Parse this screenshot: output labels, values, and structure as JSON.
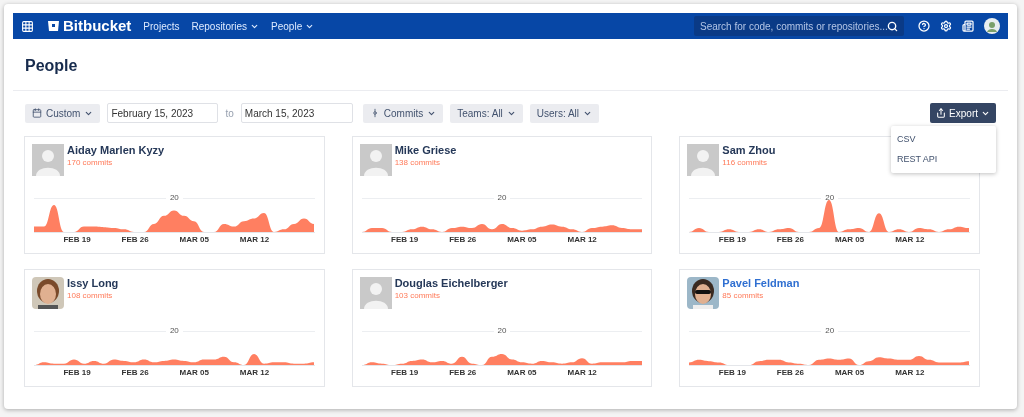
{
  "nav": {
    "product": "Bitbucket",
    "links": [
      {
        "label": "Projects",
        "has_menu": false
      },
      {
        "label": "Repositories",
        "has_menu": true
      },
      {
        "label": "People",
        "has_menu": true
      }
    ],
    "search": {
      "placeholder": "Search for code, commits or repositories..."
    }
  },
  "page": {
    "title": "People"
  },
  "filters": {
    "range": "Custom",
    "from": "February 15, 2023",
    "to_label": "to",
    "to": "March 15, 2023",
    "metric": "Commits",
    "teams": "Teams: All",
    "users": "Users: All"
  },
  "export": {
    "label": "Export",
    "expanded": true,
    "options": [
      "CSV",
      "REST API"
    ]
  },
  "people": [
    {
      "name": "Aiday Marlen Kyzy",
      "commits": "170 commits",
      "avatar": {
        "kind": "placeholder"
      },
      "highlighted": false,
      "grid_label": "20",
      "dates": [
        "FEB 19",
        "FEB 26",
        "MAR 05",
        "MAR 12"
      ]
    },
    {
      "name": "Mike Griese",
      "commits": "138 commits",
      "avatar": {
        "kind": "placeholder"
      },
      "highlighted": false,
      "grid_label": "20",
      "dates": [
        "FEB 19",
        "FEB 26",
        "MAR 05",
        "MAR 12"
      ]
    },
    {
      "name": "Sam Zhou",
      "commits": "116 commits",
      "avatar": {
        "kind": "placeholder"
      },
      "highlighted": false,
      "grid_label": "20",
      "dates": [
        "FEB 19",
        "FEB 26",
        "MAR 05",
        "MAR 12"
      ]
    },
    {
      "name": "Issy Long",
      "commits": "108 commits",
      "highlighted": false,
      "grid_label": "20",
      "dates": [
        "FEB 19",
        "FEB 26",
        "MAR 05",
        "MAR 12"
      ]
    },
    {
      "name": "Douglas Eichelberger",
      "commits": "103 commits",
      "avatar": {
        "kind": "placeholder"
      },
      "highlighted": false,
      "grid_label": "20",
      "dates": [
        "FEB 19",
        "FEB 26",
        "MAR 05",
        "MAR 12"
      ]
    },
    {
      "name": "Pavel Feldman",
      "commits": "85 commits",
      "highlighted": true,
      "grid_label": "20",
      "dates": [
        "FEB 19",
        "FEB 26",
        "MAR 05",
        "MAR 12"
      ]
    }
  ]
}
